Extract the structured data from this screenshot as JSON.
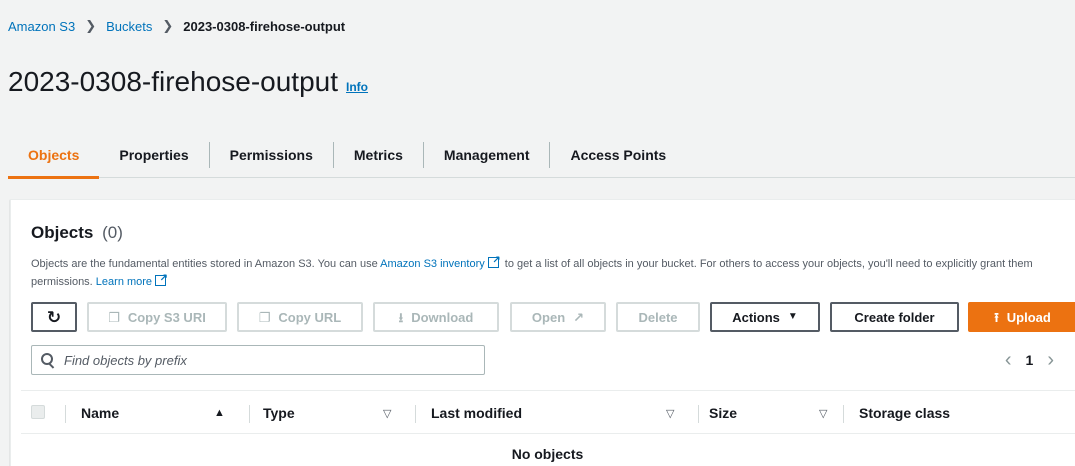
{
  "breadcrumb": {
    "items": [
      "Amazon S3",
      "Buckets"
    ],
    "current": "2023-0308-firehose-output"
  },
  "page": {
    "title": "2023-0308-firehose-output",
    "info": "Info"
  },
  "tabs": [
    "Objects",
    "Properties",
    "Permissions",
    "Metrics",
    "Management",
    "Access Points"
  ],
  "active_tab": "Objects",
  "objects_panel": {
    "title": "Objects",
    "count": "(0)",
    "description_1": "Objects are the fundamental entities stored in Amazon S3. You can use ",
    "inventory_link": "Amazon S3 inventory",
    "description_2": " to get a list of all objects in your bucket. For others to access your objects, you'll need to explicitly grant them permissions. ",
    "learn_more": "Learn more"
  },
  "toolbar": {
    "refresh_icon": "refresh-icon",
    "copy_s3_uri": "Copy S3 URI",
    "copy_url": "Copy URL",
    "download": "Download",
    "open": "Open",
    "delete": "Delete",
    "actions": "Actions",
    "create_folder": "Create folder",
    "upload": "Upload"
  },
  "search": {
    "placeholder": "Find objects by prefix",
    "value": ""
  },
  "pagination": {
    "current_page": "1"
  },
  "table": {
    "columns": [
      "Name",
      "Type",
      "Last modified",
      "Size",
      "Storage class"
    ],
    "empty_message": "No objects"
  },
  "colors": {
    "accent": "#ec7211",
    "link": "#0073bb",
    "text": "#16191f",
    "background": "#f2f3f3"
  }
}
